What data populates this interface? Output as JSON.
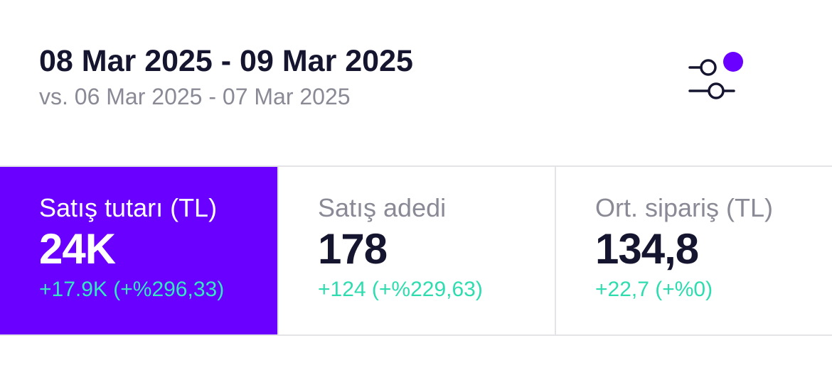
{
  "header": {
    "date_range": "08 Mar 2025 - 09 Mar 2025",
    "compare_range": "vs. 06 Mar 2025 - 07 Mar 2025"
  },
  "filter": {
    "icon": "sliders-icon",
    "indicator_color": "#6a00ff"
  },
  "metrics": [
    {
      "label": "Satış tutarı (TL)",
      "value": "24K",
      "delta": "+17.9K (+%296,33)",
      "active": true
    },
    {
      "label": "Satış adedi",
      "value": "178",
      "delta": "+124 (+%229,63)",
      "active": false
    },
    {
      "label": "Ort. sipariş (TL)",
      "value": "134,8",
      "delta": "+22,7 (+%0)",
      "active": false
    }
  ],
  "colors": {
    "accent": "#6a00ff",
    "positive_delta": "#2fdcb0",
    "primary_text": "#151530",
    "secondary_text": "#8a8a96"
  }
}
